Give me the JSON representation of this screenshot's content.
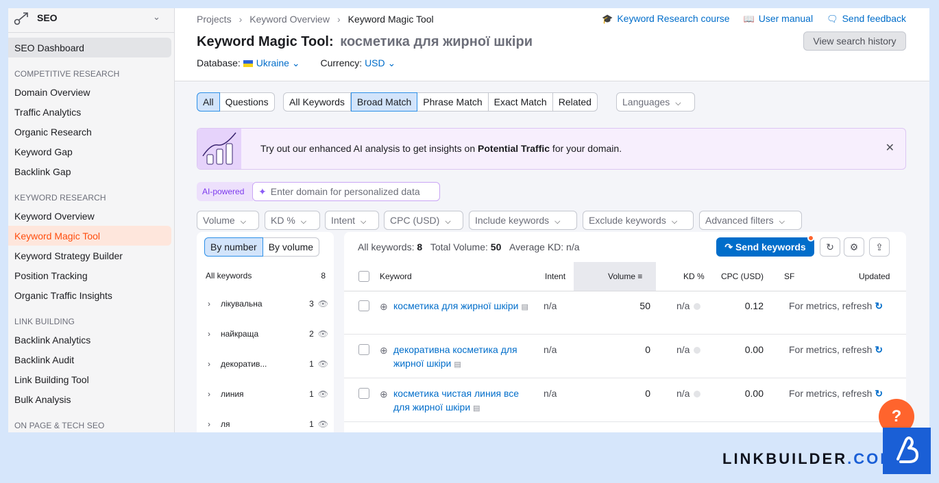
{
  "sidebar": {
    "title": "SEO",
    "dashboard": "SEO Dashboard",
    "sections": [
      {
        "label": "COMPETITIVE RESEARCH",
        "items": [
          "Domain Overview",
          "Traffic Analytics",
          "Organic Research",
          "Keyword Gap",
          "Backlink Gap"
        ]
      },
      {
        "label": "KEYWORD RESEARCH",
        "items": [
          "Keyword Overview",
          "Keyword Magic Tool",
          "Keyword Strategy Builder",
          "Position Tracking",
          "Organic Traffic Insights"
        ]
      },
      {
        "label": "LINK BUILDING",
        "items": [
          "Backlink Analytics",
          "Backlink Audit",
          "Link Building Tool",
          "Bulk Analysis"
        ]
      },
      {
        "label": "ON PAGE & TECH SEO",
        "items": []
      }
    ],
    "active_item": "Keyword Magic Tool"
  },
  "breadcrumbs": [
    "Projects",
    "Keyword Overview",
    "Keyword Magic Tool"
  ],
  "top_links": {
    "course": "Keyword Research course",
    "manual": "User manual",
    "feedback": "Send feedback"
  },
  "header": {
    "title": "Keyword Magic Tool:",
    "query": "косметика для жирної шкіри",
    "history_button": "View search history",
    "database_label": "Database:",
    "database_value": "Ukraine",
    "currency_label": "Currency:",
    "currency_value": "USD"
  },
  "tabs": {
    "type": [
      "All",
      "Questions"
    ],
    "match": [
      "All Keywords",
      "Broad Match",
      "Phrase Match",
      "Exact Match",
      "Related"
    ],
    "languages": "Languages"
  },
  "banner": {
    "text_before": "Try out our enhanced AI analysis to get insights on ",
    "text_bold": "Potential Traffic",
    "text_after": " for your domain."
  },
  "ai": {
    "badge": "AI-powered",
    "placeholder": "Enter domain for personalized data"
  },
  "filters": [
    "Volume",
    "KD %",
    "Intent",
    "CPC (USD)",
    "Include keywords",
    "Exclude keywords",
    "Advanced filters"
  ],
  "groups": {
    "toggle": [
      "By number",
      "By volume"
    ],
    "header_label": "All keywords",
    "header_count": "8",
    "rows": [
      {
        "name": "лікувальна",
        "count": "3"
      },
      {
        "name": "найкраща",
        "count": "2"
      },
      {
        "name": "декоратив...",
        "count": "1"
      },
      {
        "name": "линия",
        "count": "1"
      },
      {
        "name": "ля",
        "count": "1"
      }
    ]
  },
  "table": {
    "summary_all_label": "All keywords:",
    "summary_all_value": "8",
    "summary_volume_label": "Total Volume:",
    "summary_volume_value": "50",
    "summary_kd_label": "Average KD:",
    "summary_kd_value": "n/a",
    "send_button": "Send keywords",
    "columns": [
      "Keyword",
      "Intent",
      "Volume",
      "KD %",
      "CPC (USD)",
      "SF",
      "Updated"
    ],
    "rows": [
      {
        "keyword": "косметика для жирної шкіри",
        "intent": "n/a",
        "volume": "50",
        "kd": "n/a",
        "cpc": "0.12",
        "updated": "For metrics, refresh"
      },
      {
        "keyword": "декоративна косметика для жирної шкіри",
        "intent": "n/a",
        "volume": "0",
        "kd": "n/a",
        "cpc": "0.00",
        "updated": "For metrics, refresh"
      },
      {
        "keyword": "косметика чистая линия все для жирної шкіри",
        "intent": "n/a",
        "volume": "0",
        "kd": "n/a",
        "cpc": "0.00",
        "updated": "For metrics, refresh"
      }
    ]
  },
  "help_label": "?",
  "brand": {
    "name": "LINKBUILDER",
    "tld": ".COM"
  },
  "colors": {
    "accent": "#006dca",
    "active": "#ff4d0d",
    "brand": "#1a5fd6"
  }
}
